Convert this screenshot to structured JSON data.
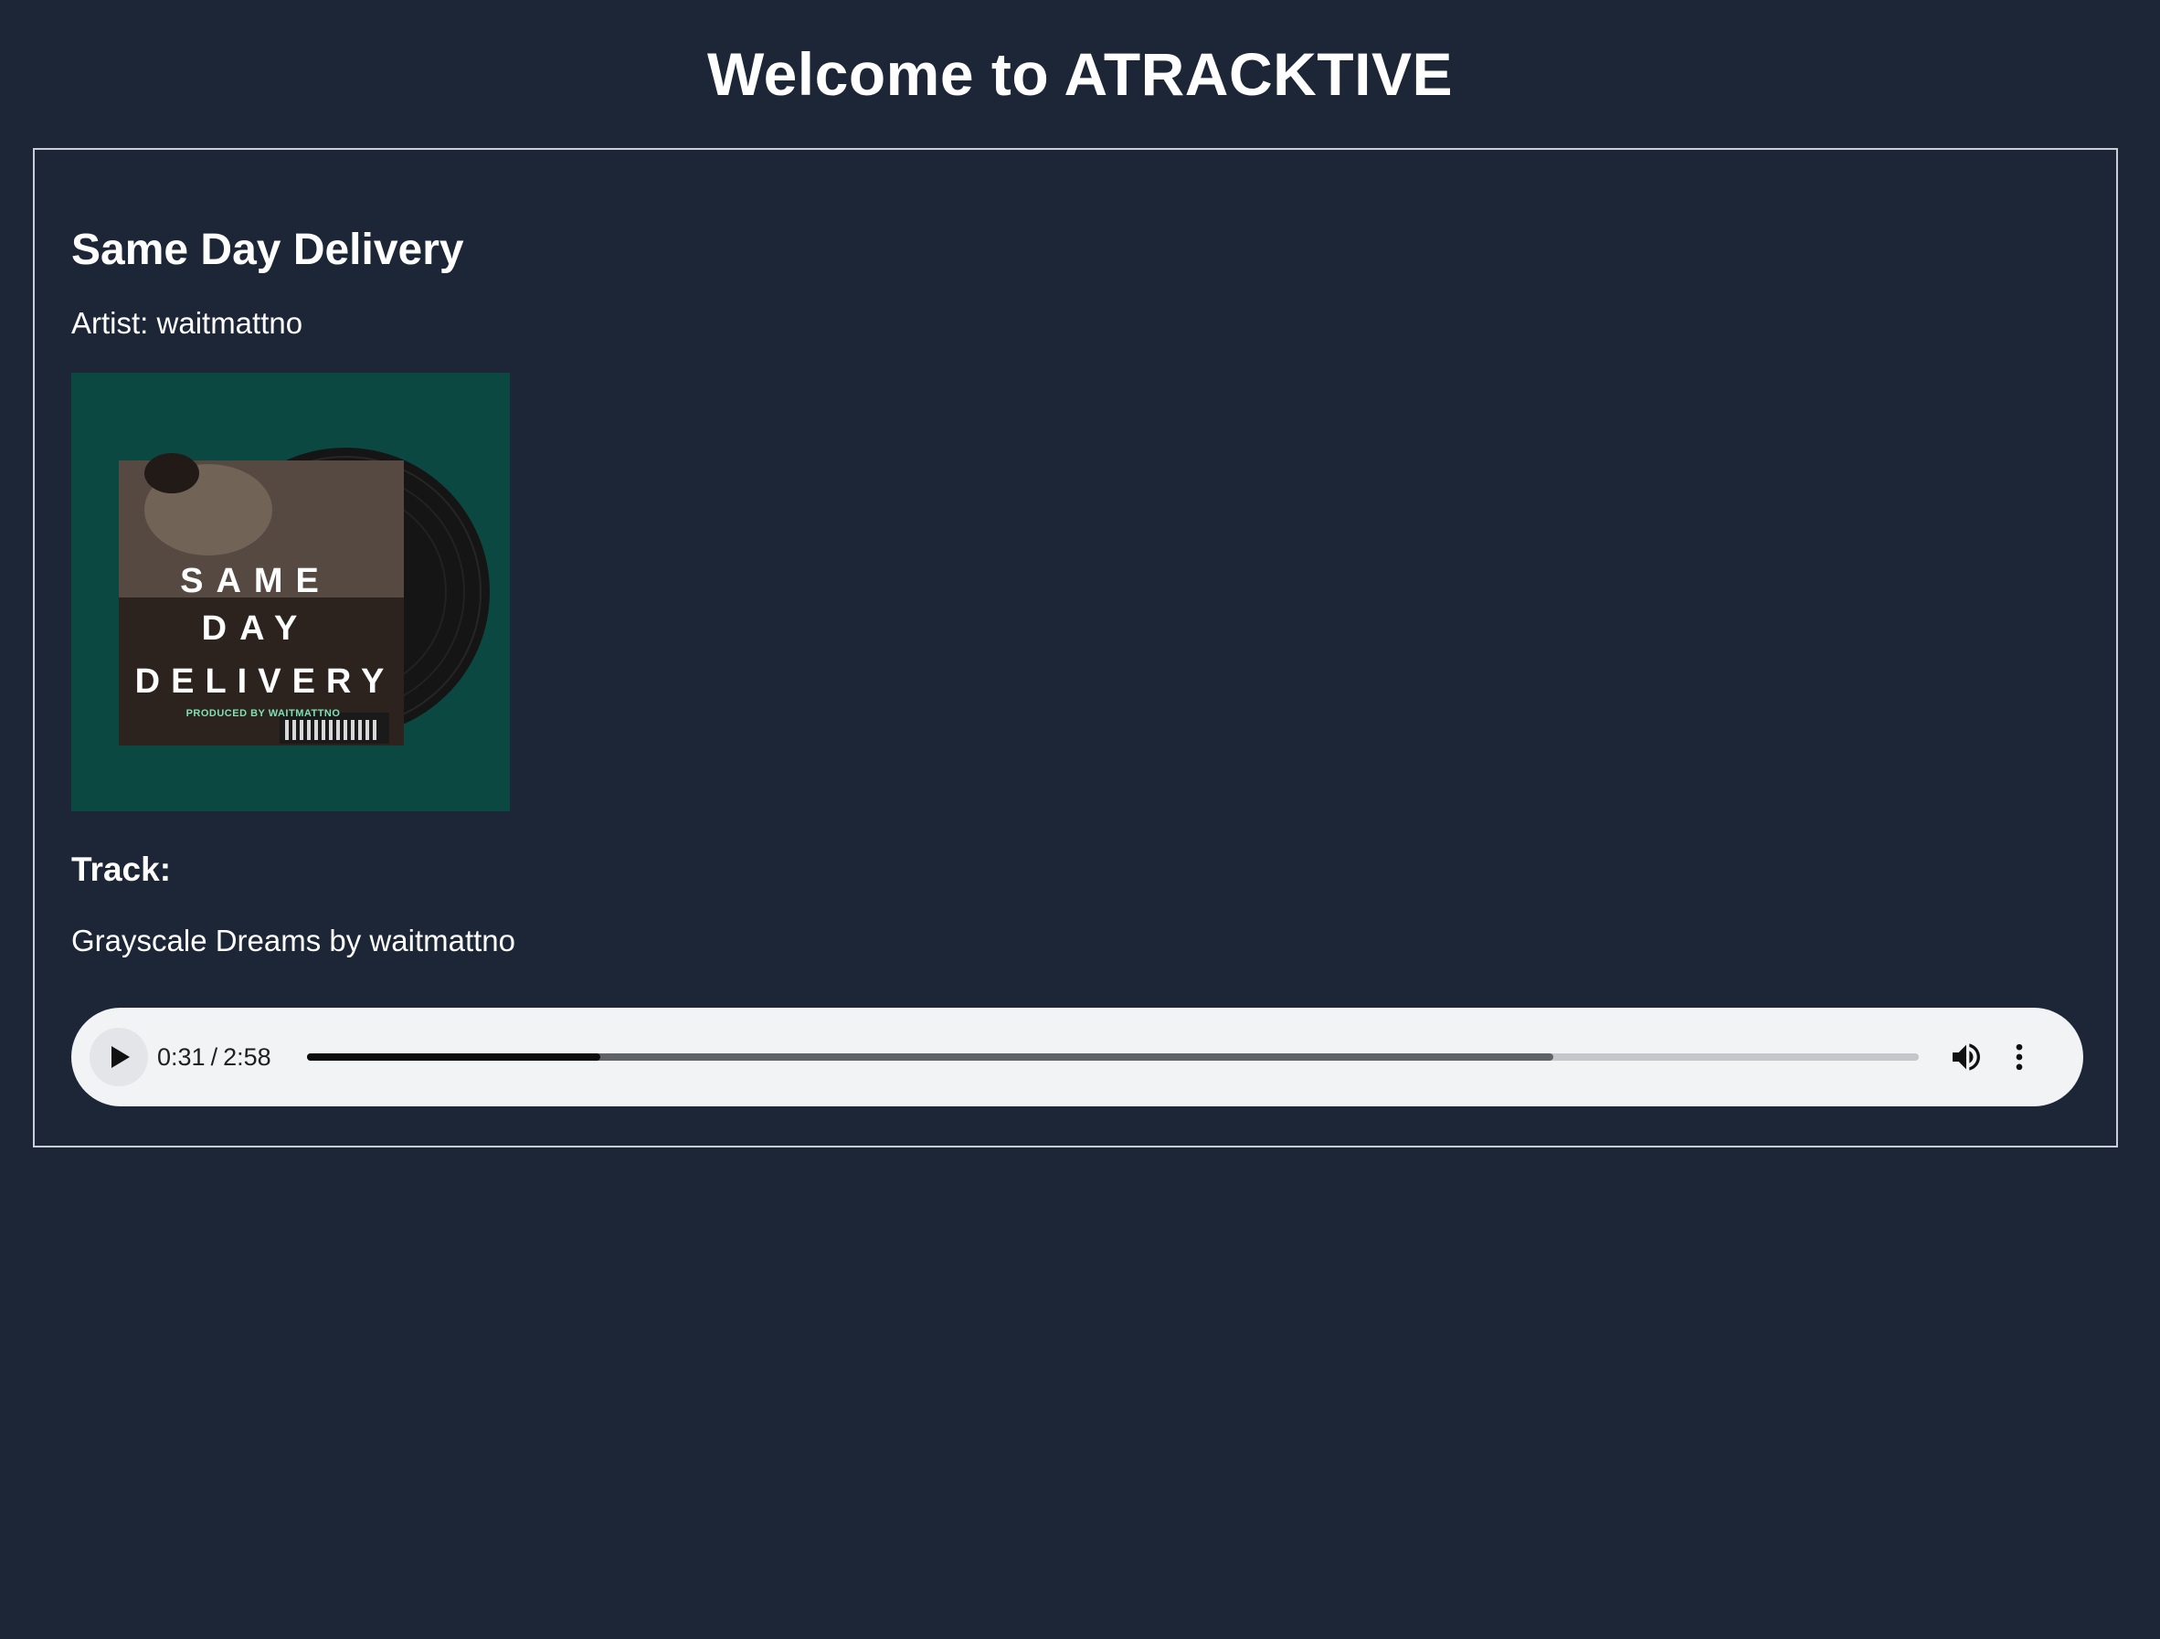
{
  "page": {
    "title": "Welcome to ATRACKTIVE"
  },
  "album": {
    "title": "Same Day Delivery",
    "artist_label": "Artist: waitmattno",
    "cover": {
      "line1": "SAME",
      "line2": "DAY",
      "line3": "DELIVERY",
      "credit": "PRODUCED BY WAITMATTNO",
      "background_color": "#0c4842"
    }
  },
  "track": {
    "heading": "Track:",
    "name": "Grayscale Dreams by waitmattno"
  },
  "player": {
    "current_time": "0:31",
    "separator": "/",
    "duration": "2:58",
    "played_fraction": 0.182,
    "buffered_fraction": 0.773,
    "play_icon": "play-icon",
    "volume_icon": "volume-icon",
    "menu_icon": "more-vert-icon"
  },
  "colors": {
    "background": "#1c2636",
    "text": "#ffffff",
    "player_bg": "#f1f3f4"
  }
}
